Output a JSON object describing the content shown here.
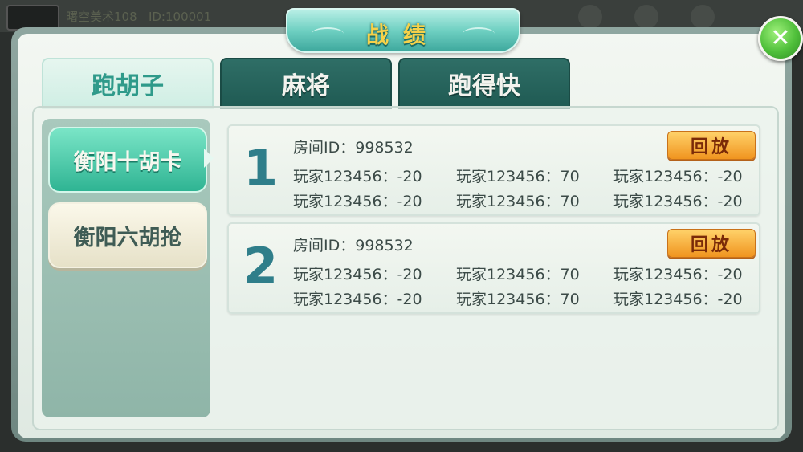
{
  "background": {
    "user_name": "曙空美术108",
    "user_id": "ID:100001"
  },
  "title": "战绩",
  "tabs": [
    {
      "label": "跑胡子",
      "active": true
    },
    {
      "label": "麻将",
      "active": false
    },
    {
      "label": "跑得快",
      "active": false
    }
  ],
  "side_menu": [
    {
      "label": "衡阳十胡卡",
      "active": true
    },
    {
      "label": "衡阳六胡抢",
      "active": false
    }
  ],
  "records": [
    {
      "index": "1",
      "room": "房间ID：998532",
      "replay_label": "回放",
      "players": [
        "玩家123456：-20",
        "玩家123456：70",
        "玩家123456：-20",
        "玩家123456：-20",
        "玩家123456：70",
        "玩家123456：-20"
      ]
    },
    {
      "index": "2",
      "room": "房间ID：998532",
      "replay_label": "回放",
      "players": [
        "玩家123456：-20",
        "玩家123456：70",
        "玩家123456：-20",
        "玩家123456：-20",
        "玩家123456：70",
        "玩家123456：-20"
      ]
    }
  ],
  "colors": {
    "accent_teal": "#2fb493",
    "replay_orange": "#f0941f",
    "title_gold": "#f6d14a"
  },
  "icons": {
    "close": "close-icon",
    "arrow": "chevron-right-icon"
  }
}
